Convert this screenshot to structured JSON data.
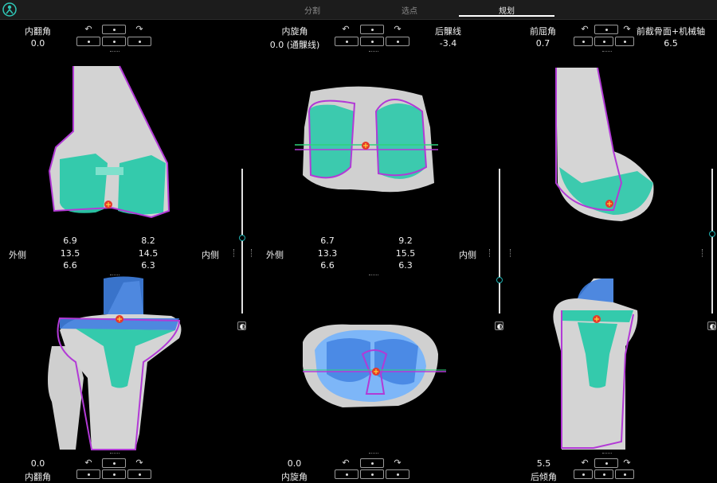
{
  "nav": {
    "tabs": [
      {
        "label": "分割"
      },
      {
        "label": "选点"
      },
      {
        "label": "规划"
      }
    ],
    "active_tab": "规划"
  },
  "panels": {
    "left_top": {
      "label": "内翻角",
      "value": "0.0"
    },
    "center_top": {
      "label": "内旋角",
      "value": "0.0 (通髁线)"
    },
    "center_top_right": {
      "label": "后髁线",
      "value": "-3.4"
    },
    "right_top": {
      "label": "前屈角",
      "value": "0.7"
    },
    "right_top_right": {
      "label": "前截骨面+机械轴",
      "value": "6.5"
    },
    "left_bottom": {
      "label": "内翻角",
      "value": "0.0"
    },
    "center_bottom": {
      "label": "内旋角",
      "value": "0.0"
    },
    "right_bottom": {
      "label": "后倾角",
      "value": "5.5"
    }
  },
  "gaps": {
    "left": {
      "lateral_label": "外侧",
      "medial_label": "内侧",
      "lat_top": "6.9",
      "lat_mid": "13.5",
      "lat_bot": "6.6",
      "med_top": "8.2",
      "med_mid": "14.5",
      "med_bot": "6.3"
    },
    "center": {
      "lateral_label": "外侧",
      "medial_label": "内侧",
      "lat_top": "6.7",
      "lat_mid": "13.3",
      "lat_bot": "6.6",
      "med_top": "9.2",
      "med_mid": "15.5",
      "med_bot": "6.3"
    }
  },
  "sliders": [
    {
      "name": "left",
      "level": 0.48
    },
    {
      "name": "center",
      "level": 0.77
    },
    {
      "name": "right",
      "level": 0.45
    }
  ],
  "colors": {
    "bone": "#d9d9d9",
    "implant_teal": "#2fd1b0",
    "outline_purple": "#b23ad6",
    "tibia_blue": "#3f7fe0",
    "accent": "#1fb0b0",
    "marker_red": "#e53a2a"
  },
  "icons": {
    "rotate_ccw": "↶",
    "rotate_cw": "↷"
  }
}
